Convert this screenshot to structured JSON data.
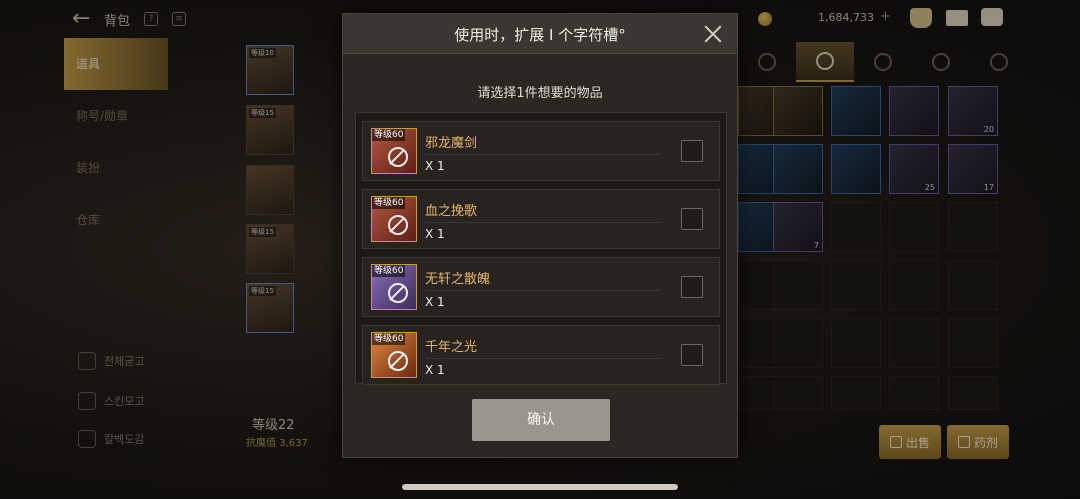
{
  "header": {
    "title": "背包",
    "gold_amount": "1,684,733",
    "plus": "+"
  },
  "sidebar": {
    "items": [
      {
        "label": "道具"
      },
      {
        "label": "称号/勋章"
      },
      {
        "label": "装扮"
      },
      {
        "label": "仓库"
      }
    ],
    "bottom": [
      {
        "label": "전체굳고"
      },
      {
        "label": "스킨모고"
      },
      {
        "label": "칼백도감"
      }
    ]
  },
  "equipment": {
    "slots": [
      {
        "tag": "等级10"
      },
      {
        "tag": "等级15"
      },
      {
        "tag": ""
      },
      {
        "tag": "等级15"
      },
      {
        "tag": "等级15"
      }
    ]
  },
  "character": {
    "level": "等级22",
    "stat": "抗魔值 3,637"
  },
  "inventory": {
    "quantities": [
      "20",
      "25",
      "17",
      "17",
      "7"
    ]
  },
  "actions": {
    "sell_label": "出售",
    "decompose_label": "药剂"
  },
  "modal": {
    "title": "使用时，扩展 I 个字符槽°",
    "prompt": "请选择1件想要的物品",
    "confirm_label": "确认",
    "items": [
      {
        "level": "等级60",
        "name": "邪龙魔剑",
        "qty": "X 1"
      },
      {
        "level": "等级60",
        "name": "血之挽歌",
        "qty": "X 1"
      },
      {
        "level": "等级60",
        "name": "无轩之散魄",
        "qty": "X 1"
      },
      {
        "level": "等级60",
        "name": "千年之光",
        "qty": "X 1"
      }
    ]
  },
  "colors": {
    "accent": "#c9a24a",
    "item_name": "#e5b66a",
    "confirm_bg": "#9a968f"
  }
}
